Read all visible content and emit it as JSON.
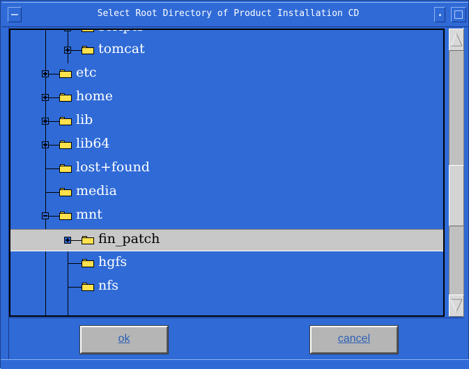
{
  "window": {
    "title": "Select Root Directory of Product Installation CD"
  },
  "tree": {
    "items": [
      {
        "label": "scripts",
        "expander": "plus",
        "depth": 1
      },
      {
        "label": "tomcat",
        "expander": "plus",
        "depth": 1
      },
      {
        "label": "etc",
        "expander": "plus",
        "depth": 0
      },
      {
        "label": "home",
        "expander": "plus",
        "depth": 0
      },
      {
        "label": "lib",
        "expander": "plus",
        "depth": 0
      },
      {
        "label": "lib64",
        "expander": "plus",
        "depth": 0
      },
      {
        "label": "lost+found",
        "expander": "none",
        "depth": 0
      },
      {
        "label": "media",
        "expander": "none",
        "depth": 0
      },
      {
        "label": "mnt",
        "expander": "minus",
        "depth": 0
      },
      {
        "label": "fin_patch",
        "expander": "plus",
        "depth": 1,
        "selected": true
      },
      {
        "label": "hgfs",
        "expander": "none",
        "depth": 1
      },
      {
        "label": "nfs",
        "expander": "none",
        "depth": 1
      }
    ]
  },
  "buttons": {
    "ok_label": "ok",
    "cancel_label": "cancel"
  },
  "colors": {
    "background": "#2f6ad6",
    "selection": "#c8c8c8",
    "folder": "#ffe14d"
  },
  "icons": {
    "folder": "folder-icon",
    "expand": "plus-box-icon",
    "collapse": "minus-box-icon",
    "scroll_up": "arrow-up-icon",
    "scroll_down": "arrow-down-icon"
  }
}
